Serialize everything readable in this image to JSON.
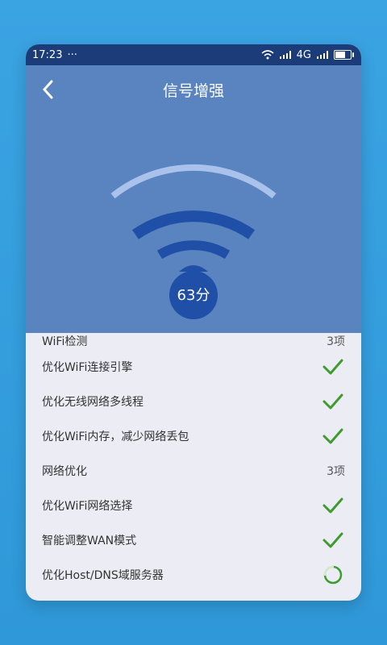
{
  "status": {
    "time": "17:23",
    "dots": "···",
    "network": "4G"
  },
  "header": {
    "title": "信号增强"
  },
  "score": {
    "text": "63分"
  },
  "sections": [
    {
      "title": "WiFi检测",
      "count": "3项",
      "items": [
        "优化WiFi连接引擎",
        "优化无线网络多线程",
        "优化WiFi内存，减少网络丢包"
      ]
    },
    {
      "title": "网络优化",
      "count": "3项",
      "items": [
        "优化WiFi网络选择",
        "智能调整WAN模式",
        "优化Host/DNS域服务器"
      ]
    }
  ],
  "colors": {
    "accent_check": "#3e9b2d",
    "hero_bg": "#5a84bf",
    "status_bar": "#1b3c78",
    "wifi_blue": "#1f4fa6"
  },
  "icons": [
    "back-arrow-icon",
    "wifi-icon",
    "signal-icon",
    "battery-icon",
    "check-icon",
    "loading-icon"
  ]
}
